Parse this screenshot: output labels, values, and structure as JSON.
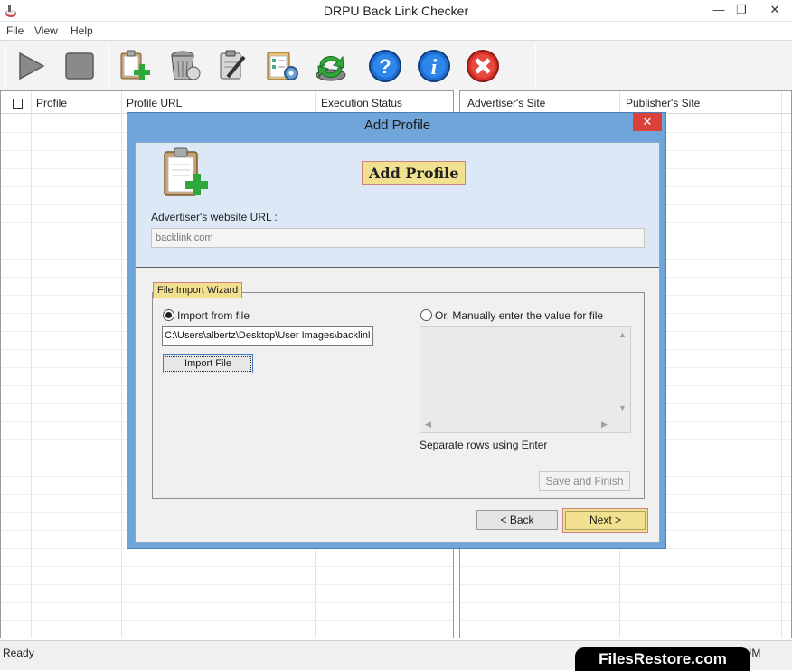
{
  "window": {
    "title": "DRPU Back Link Checker",
    "controls": {
      "minimize": "—",
      "restore": "❐",
      "close": "✕"
    }
  },
  "menu": {
    "items": [
      "File",
      "View",
      "Help"
    ]
  },
  "toolbar": {
    "buttons": [
      "play-icon",
      "stop-icon",
      "add-profile-icon",
      "delete-icon",
      "edit-icon",
      "settings-icon",
      "refresh-icon",
      "help-icon",
      "info-icon",
      "exit-icon"
    ]
  },
  "left_grid": {
    "columns": [
      "Profile",
      "Profile URL",
      "Execution Status"
    ]
  },
  "right_grid": {
    "columns": [
      "Advertiser's Site",
      "Publisher's Site"
    ]
  },
  "status": {
    "text": "Ready",
    "num": "NUM"
  },
  "watermark": "FilesRestore.com",
  "dialog": {
    "title": "Add Profile",
    "close": "✕",
    "heading": "Add Profile",
    "url_label": "Advertiser's website URL :",
    "url_placeholder": "backlink.com",
    "wizard": {
      "legend": "File Import Wizard",
      "import_option": "Import from file",
      "import_selected": true,
      "file_path": "C:\\Users\\albertz\\Desktop\\User Images\\backlinl",
      "import_button": "Import File",
      "manual_option": "Or, Manually enter the value for file",
      "manual_selected": false,
      "manual_value": "",
      "hint": "Separate rows using Enter",
      "save_button": "Save and Finish"
    },
    "back_button": "< Back",
    "next_button": "Next >"
  }
}
